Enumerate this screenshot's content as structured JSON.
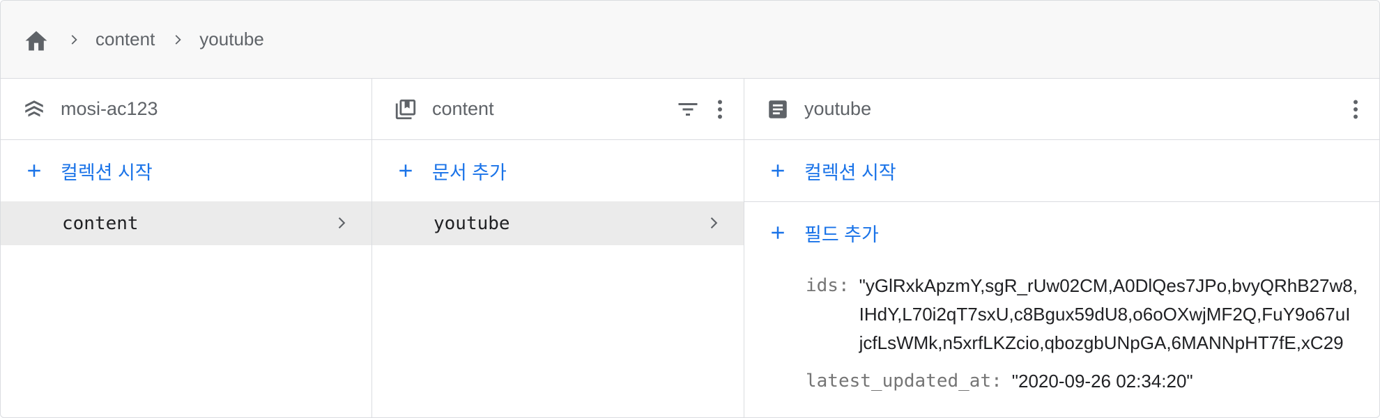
{
  "breadcrumb": {
    "home_icon": "home-icon",
    "items": [
      "content",
      "youtube"
    ]
  },
  "columns": {
    "project": {
      "icon": "firestore-icon",
      "title": "mosi-ac123",
      "add_label": "컬렉션 시작",
      "items": [
        {
          "label": "content",
          "selected": true
        }
      ]
    },
    "collection": {
      "icon": "collection-icon",
      "title": "content",
      "add_label": "문서 추가",
      "items": [
        {
          "label": "youtube",
          "selected": true
        }
      ]
    },
    "document": {
      "icon": "document-icon",
      "title": "youtube",
      "add_collection_label": "컬렉션 시작",
      "add_field_label": "필드 추가",
      "fields": {
        "ids": {
          "key": "ids:",
          "lines": [
            "\"yGlRxkApzmY,sgR_rUw02CM,A0DlQes7JPo,bvyQRhB27w8,",
            "IHdY,L70i2qT7sxU,c8Bgux59dU8,o6oOXwjMF2Q,FuY9o67uI",
            "jcfLsWMk,n5xrfLKZcio,qbozgbUNpGA,6MANNpHT7fE,xC29"
          ]
        },
        "latest_updated_at": {
          "key": "latest_updated_at:",
          "value": "\"2020-09-26 02:34:20\""
        }
      }
    }
  },
  "colors": {
    "accent": "#1a73e8",
    "selected_bg": "#ebebeb",
    "icon_gray": "#5f6368"
  }
}
